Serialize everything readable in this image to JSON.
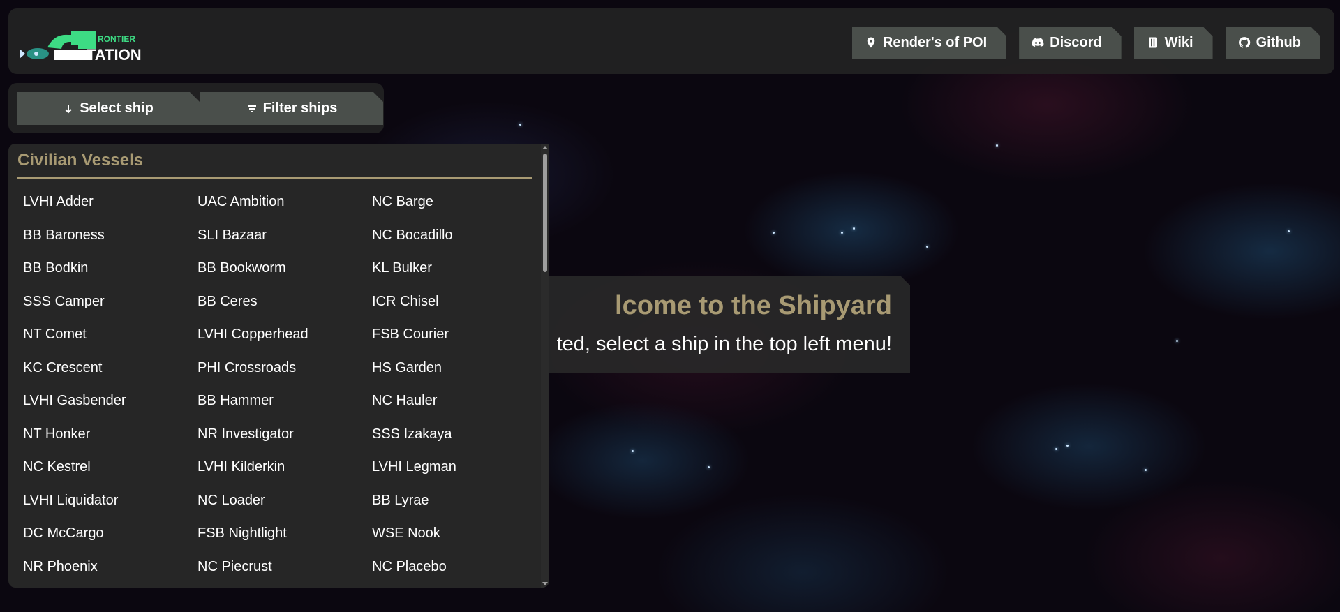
{
  "brand": {
    "logo_small_text": "RONTIER",
    "logo_big_text": "TATION"
  },
  "nav": {
    "links": [
      {
        "label": "Render's of POI",
        "icon": "map-pin-icon"
      },
      {
        "label": "Discord",
        "icon": "discord-icon"
      },
      {
        "label": "Wiki",
        "icon": "book-icon"
      },
      {
        "label": "Github",
        "icon": "github-icon"
      }
    ]
  },
  "controls": {
    "select_label": "Select ship",
    "select_icon": "arrow-down-icon",
    "filter_label": "Filter ships",
    "filter_icon": "filter-icon"
  },
  "ship_list": {
    "section_title": "Civilian Vessels",
    "ships": [
      "LVHI Adder",
      "UAC Ambition",
      "NC Barge",
      "BB Baroness",
      "SLI Bazaar",
      "NC Bocadillo",
      "BB Bodkin",
      "BB Bookworm",
      "KL Bulker",
      "SSS Camper",
      "BB Ceres",
      "ICR Chisel",
      "NT Comet",
      "LVHI Copperhead",
      "FSB Courier",
      "KC Crescent",
      "PHI Crossroads",
      "HS Garden",
      "LVHI Gasbender",
      "BB Hammer",
      "NC Hauler",
      "NT Honker",
      "NR Investigator",
      "SSS Izakaya",
      "NC Kestrel",
      "LVHI Kilderkin",
      "LVHI Legman",
      "LVHI Liquidator",
      "NC Loader",
      "BB Lyrae",
      "DC McCargo",
      "FSB Nightlight",
      "WSE Nook",
      "NR Phoenix",
      "NC Piecrust",
      "NC Placebo"
    ]
  },
  "welcome": {
    "title": "lcome to the Shipyard",
    "subtitle": "ted, select a ship in the top left menu!"
  },
  "colors": {
    "accent": "#a89a73",
    "button_bg": "#4a4f4b",
    "panel_bg": "#262626",
    "logo_green": "#3ddc84"
  }
}
